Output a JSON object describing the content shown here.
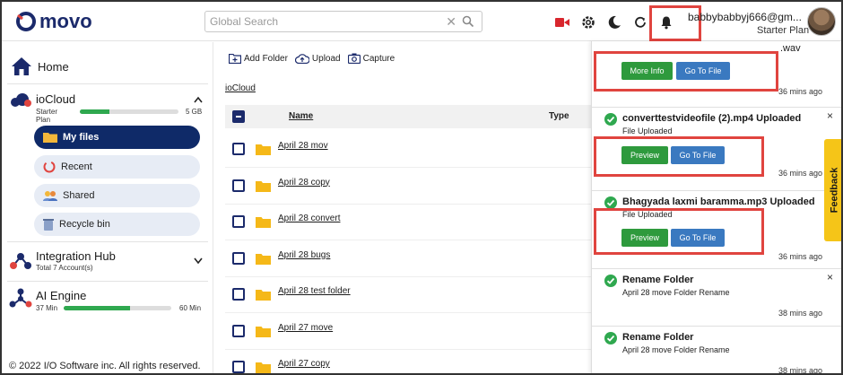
{
  "header": {
    "logo_text": "movo",
    "search_placeholder": "Global Search",
    "user_email": "babbybabbyj666@gm...",
    "user_plan": "Starter Plan"
  },
  "sidebar": {
    "home_label": "Home",
    "iocloud": {
      "title": "ioCloud",
      "plan": "Starter Plan",
      "storage_cap": "5 GB",
      "storage_fraction": 0.3
    },
    "items": [
      {
        "label": "My files",
        "icon": "folder-icon",
        "active": true
      },
      {
        "label": "Recent",
        "icon": "recent-icon",
        "active": false
      },
      {
        "label": "Shared",
        "icon": "shared-icon",
        "active": false
      },
      {
        "label": "Recycle bin",
        "icon": "recycle-bin-icon",
        "active": false
      }
    ],
    "integration_hub": {
      "title": "Integration Hub",
      "subtitle": "Total 7 Account(s)"
    },
    "ai_engine": {
      "title": "AI Engine",
      "used": "37 Min",
      "total": "60 Min",
      "usage_fraction": 0.62
    },
    "copyright": "© 2022 I/O Software inc. All rights reserved."
  },
  "main": {
    "toolbar": {
      "add_folder": "Add Folder",
      "upload": "Upload",
      "capture": "Capture"
    },
    "breadcrumb": "ioCloud",
    "columns": {
      "name": "Name",
      "type": "Type"
    },
    "rows": [
      "April 28 mov",
      "April 28 copy",
      "April 28 convert",
      "April 28 bugs",
      "April 28 test folder",
      "April 27 move",
      "April 27 copy"
    ]
  },
  "notifications": {
    "top_fragment": ".wav",
    "top_buttons": {
      "more_info": "More Info",
      "go_to_file": "Go To File"
    },
    "top_time": "36 mins ago",
    "cards": [
      {
        "title": "converttestvideofile (2).mp4 Uploaded",
        "subtitle": "File Uploaded",
        "time": "36 mins ago",
        "btn1": "Preview",
        "btn2": "Go To File"
      },
      {
        "title": "Bhagyada laxmi baramma.mp3 Uploaded",
        "subtitle": "File Uploaded",
        "time": "36 mins ago",
        "btn1": "Preview",
        "btn2": "Go To File"
      },
      {
        "title": "Rename Folder",
        "subtitle": "April 28 move Folder Rename",
        "time": "38 mins ago"
      },
      {
        "title": "Rename Folder",
        "subtitle": "April 28 move Folder Rename",
        "time": "38 mins ago"
      }
    ],
    "close_glyph": "×"
  },
  "feedback_label": "Feedback",
  "colors": {
    "brand_navy": "#0f2a68",
    "accent_red": "#e0443f",
    "success_green": "#2e9a3d",
    "action_blue": "#3a79c0",
    "feedback_yellow": "#f5c518"
  }
}
